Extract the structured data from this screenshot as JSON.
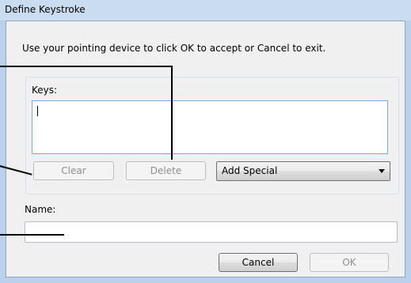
{
  "window": {
    "title": "Define Keystroke"
  },
  "instruction": "Use your pointing device to click OK to accept or Cancel to exit.",
  "keys": {
    "label": "Keys:",
    "value": ""
  },
  "buttons": {
    "clear": "Clear",
    "delete": "Delete",
    "cancel": "Cancel",
    "ok": "OK"
  },
  "add_special": {
    "selected": "Add Special"
  },
  "name": {
    "label": "Name:",
    "value": ""
  },
  "icons": [
    "chevron-down-icon"
  ]
}
